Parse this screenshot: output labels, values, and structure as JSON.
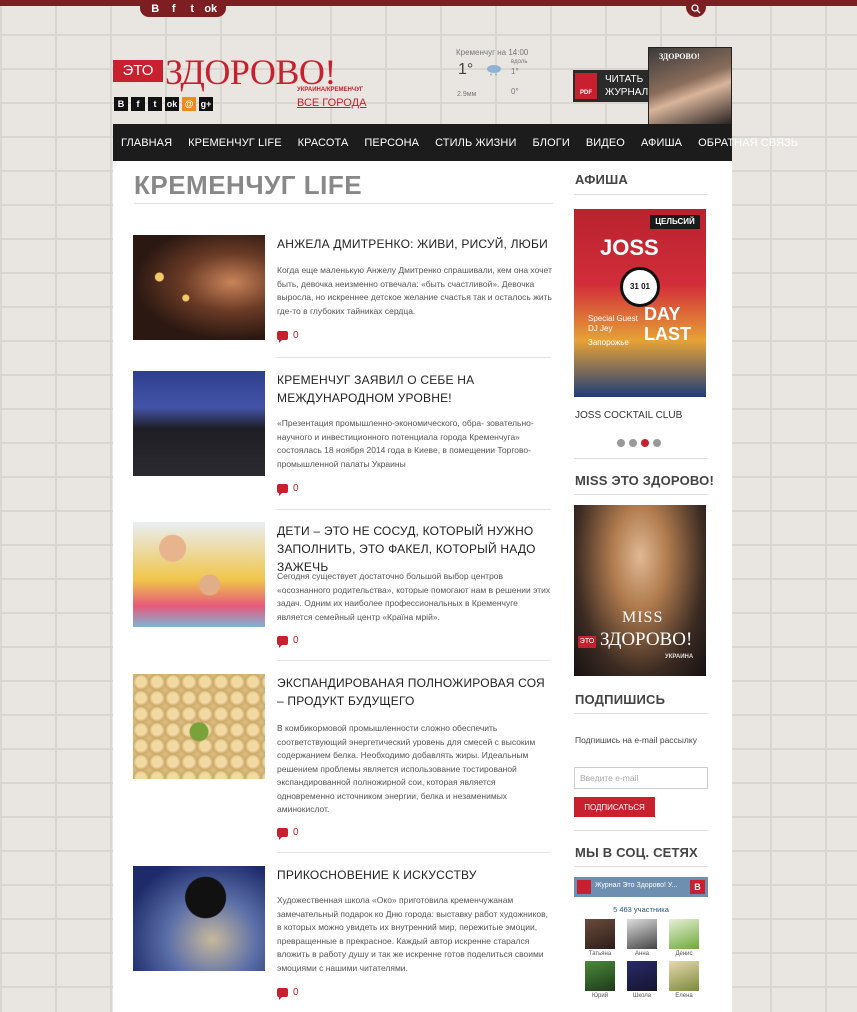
{
  "header": {
    "top_social_icons": [
      "vk-icon",
      "facebook-icon",
      "twitter-icon",
      "odnoklassniki-icon"
    ],
    "top_social_glyphs": [
      "B",
      "f",
      "t",
      "ok"
    ],
    "logo": {
      "eto": "ЭТО",
      "main": "ЗДОРОВО!",
      "sub": "УКРАИНА/КРЕМЕНЧУГ"
    },
    "head_social_glyphs": [
      "B",
      "f",
      "t",
      "ok",
      "@",
      "g+"
    ],
    "all_cities": "ВСЕ ГОРОДА",
    "weather": {
      "city_time": "Кременчуг на 14:00",
      "temp": "1°",
      "wind_dir": "вдоль",
      "temp2": "1°",
      "rain": "2.9мм",
      "temp3": "0°"
    },
    "read_magazine": {
      "line1": "ЧИТАТЬ",
      "line2": "ЖУРНАЛ",
      "pdf": "PDF"
    },
    "magazine_title": "ЗДОРОВО!"
  },
  "nav": {
    "items": [
      "ГЛАВНАЯ",
      "КРЕМЕНЧУГ LIFE",
      "КРАСОТА",
      "ПЕРСОНА",
      "СТИЛЬ ЖИЗНИ",
      "БЛОГИ",
      "ВИДЕО",
      "АФИША",
      "ОБРАТНАЯ СВЯЗЬ"
    ]
  },
  "main": {
    "page_title": "КРЕМЕНЧУГ LIFE",
    "articles": [
      {
        "title": "АНЖЕЛА ДМИТРЕНКО: ЖИВИ, РИСУЙ, ЛЮБИ",
        "text": "Когда еще маленькую Анжелу Дмитренко спрашивали, кем она хочет быть, девочка неизменно отвечала: «быть счастливой». Девочка выросла, но искреннее детское желание счастья так и осталось жить где-то в глубоких тайниках сердца.",
        "comments": "0"
      },
      {
        "title": "КРЕМЕНЧУГ ЗАЯВИЛ О СЕБЕ НА МЕЖДУНАРОДНОМ УРОВНЕ!",
        "text": "«Презентация промышленно-экономического, обра- зовательно-научного и инвестиционного потенциала города Кременчуга» состоялась 18 ноября 2014 года в Киеве, в помещении Торгово-промышленной палаты Украины",
        "comments": "0"
      },
      {
        "title": "ДЕТИ – ЭТО НЕ СОСУД, КОТОРЫЙ НУЖНО ЗАПОЛНИТЬ, ЭТО ФАКЕЛ, КОТОРЫЙ НАДО ЗАЖЕЧЬ",
        "text": "Сегодня существует достаточно большой выбор центров «осознанного родительства», которые помогают нам в решении этих задач. Одним их наиболее профессиональных в Кременчуге является семейный центр «Країна мрій».",
        "comments": "0"
      },
      {
        "title": "ЭКСПАНДИРОВАНАЯ ПОЛНОЖИРОВАЯ СОЯ – ПРОДУКТ БУДУЩЕГО",
        "text": "В комбикормовой промышленности сложно обеспечить соответствующий энергетический уровень для смесей с высоким содержанием белка. Необходимо добавлять жиры. Идеальным решением проблемы является использование тостированой экспандированной полножирной сои, которая является одновременно источником энергии, белка и незаменимых аминокислот.",
        "comments": "0"
      },
      {
        "title": "ПРИКОСНОВЕНИЕ К ИСКУССТВУ",
        "text": "Художественная школа «Око» приготовила кременчужанам замечательный подарок ко Дню города: выставку работ художников, в которых можно увидеть их внутренний мир, пережитые эмоции, превращенные в прекрасное. Каждый автор искренне старался вложить в работу душу и так же искренне готов поделиться своими эмоциями с нашими читателями.",
        "comments": "0"
      }
    ]
  },
  "sidebar": {
    "afisha_title": "АФИША",
    "afisha_poster": {
      "club": "ЦЕЛЬСИЙ",
      "name": "JOSS",
      "date": "31 01",
      "guest": "Special Guest DJ Jey",
      "city": "Запорожье",
      "event": "DAY LAST"
    },
    "afisha_caption": "JOSS COCKTAIL CLUB",
    "miss_title": "MISS ЭТО ЗДОРОВО!",
    "miss_poster": {
      "miss": "MISS",
      "eto": "ЭТО",
      "main": "ЗДОРОВО!",
      "country": "УКРАИНА"
    },
    "subscribe_title": "ПОДПИШИСЬ",
    "subscribe_text": "Подпишись на e-mail рассылку",
    "email_placeholder": "Введите e-mail",
    "subscribe_button": "ПОДПИСАТЬСЯ",
    "social_title": "МЫ В СОЦ. СЕТЯХ",
    "vk": {
      "group_name": "Журнал Это Здорово! У...",
      "logo": "B",
      "members_count": "5 463 участника",
      "members": [
        "Татьяна",
        "Анна",
        "Денис",
        "Юрий",
        "Школа",
        "Елена"
      ]
    }
  },
  "colors": {
    "brand_red": "#c8202e",
    "nav_bg": "#1c1c1c",
    "top_bar": "#7d1e23"
  }
}
